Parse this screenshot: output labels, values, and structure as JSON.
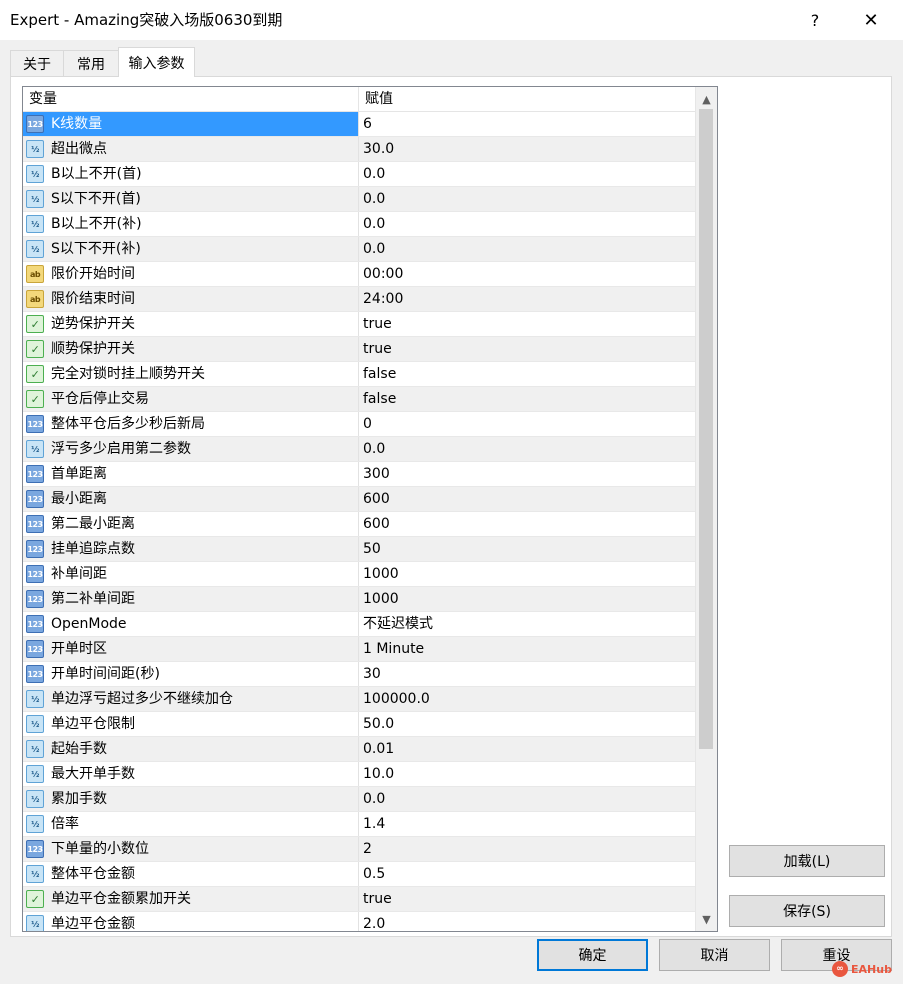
{
  "window": {
    "title": "Expert - Amazing突破入场版0630到期",
    "help_label": "?",
    "close_label": "✕"
  },
  "tabs": [
    {
      "label": "关于"
    },
    {
      "label": "常用"
    },
    {
      "label": "输入参数"
    }
  ],
  "grid": {
    "headers": {
      "variable": "变量",
      "value": "赋值"
    },
    "rows": [
      {
        "name": "K线数量",
        "value": "6",
        "type": "int"
      },
      {
        "name": "超出微点",
        "value": "30.0",
        "type": "double"
      },
      {
        "name": "B以上不开(首)",
        "value": "0.0",
        "type": "double"
      },
      {
        "name": "S以下不开(首)",
        "value": "0.0",
        "type": "double"
      },
      {
        "name": "B以上不开(补)",
        "value": "0.0",
        "type": "double"
      },
      {
        "name": "S以下不开(补)",
        "value": "0.0",
        "type": "double"
      },
      {
        "name": "限价开始时间",
        "value": "00:00",
        "type": "string"
      },
      {
        "name": "限价结束时间",
        "value": "24:00",
        "type": "string"
      },
      {
        "name": "逆势保护开关",
        "value": "true",
        "type": "bool"
      },
      {
        "name": "顺势保护开关",
        "value": "true",
        "type": "bool"
      },
      {
        "name": "完全对锁时挂上顺势开关",
        "value": "false",
        "type": "bool"
      },
      {
        "name": "平仓后停止交易",
        "value": "false",
        "type": "bool"
      },
      {
        "name": "整体平仓后多少秒后新局",
        "value": "0",
        "type": "int"
      },
      {
        "name": "浮亏多少启用第二参数",
        "value": "0.0",
        "type": "double"
      },
      {
        "name": "首单距离",
        "value": "300",
        "type": "int"
      },
      {
        "name": "最小距离",
        "value": "600",
        "type": "int"
      },
      {
        "name": "第二最小距离",
        "value": "600",
        "type": "int"
      },
      {
        "name": "挂单追踪点数",
        "value": "50",
        "type": "int"
      },
      {
        "name": "补单间距",
        "value": "1000",
        "type": "int"
      },
      {
        "name": "第二补单间距",
        "value": "1000",
        "type": "int"
      },
      {
        "name": "OpenMode",
        "value": "不延迟模式",
        "type": "int"
      },
      {
        "name": "开单时区",
        "value": "1 Minute",
        "type": "int"
      },
      {
        "name": "开单时间间距(秒)",
        "value": "30",
        "type": "int"
      },
      {
        "name": "单边浮亏超过多少不继续加仓",
        "value": "100000.0",
        "type": "double"
      },
      {
        "name": "单边平仓限制",
        "value": "50.0",
        "type": "double"
      },
      {
        "name": "起始手数",
        "value": "0.01",
        "type": "double"
      },
      {
        "name": "最大开单手数",
        "value": "10.0",
        "type": "double"
      },
      {
        "name": "累加手数",
        "value": "0.0",
        "type": "double"
      },
      {
        "name": "倍率",
        "value": "1.4",
        "type": "double"
      },
      {
        "name": "下单量的小数位",
        "value": "2",
        "type": "int"
      },
      {
        "name": "整体平仓金额",
        "value": "0.5",
        "type": "double"
      },
      {
        "name": "单边平仓金额累加开关",
        "value": "true",
        "type": "bool"
      },
      {
        "name": "单边平仓金额",
        "value": "2.0",
        "type": "double"
      }
    ],
    "selected_index": 0
  },
  "icons": {
    "int": "123",
    "double": "½",
    "string": "ab",
    "bool": "✓"
  },
  "buttons": {
    "load": "加载(L)",
    "save": "保存(S)",
    "ok": "确定",
    "cancel": "取消",
    "reset": "重设"
  },
  "watermark": {
    "text": "EAHub"
  },
  "colors": {
    "selection": "#3399ff",
    "alt_row": "#f0f0f0",
    "ok_border": "#0078d7"
  }
}
